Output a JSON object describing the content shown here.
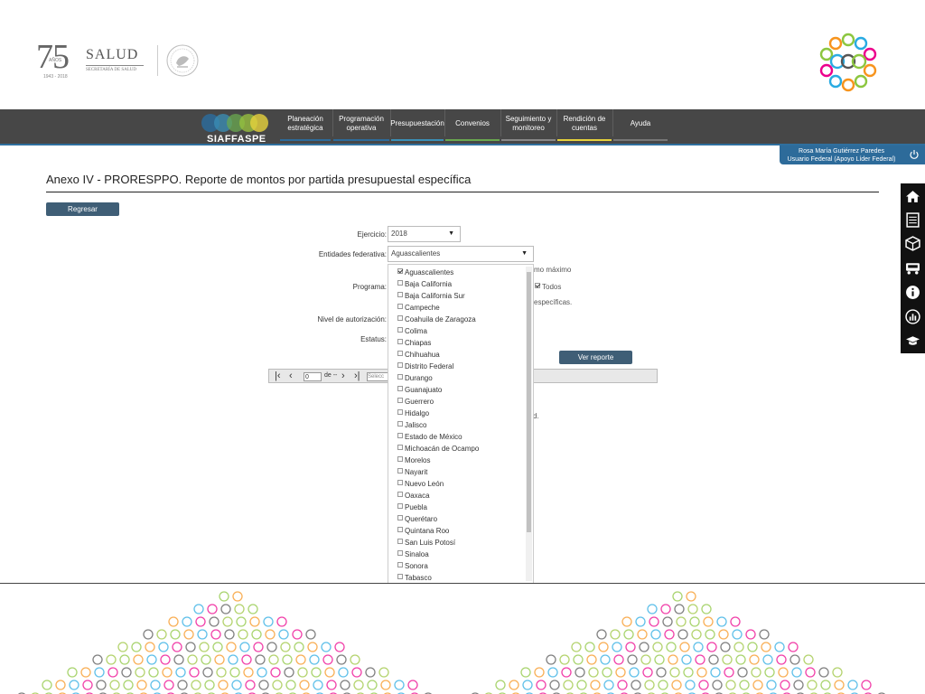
{
  "header": {
    "logo_75_number": "75",
    "logo_75_anos": "AÑOS",
    "logo_75_years": "1943 - 2018",
    "salud_title": "SALUD",
    "salud_subtitle": "SECRETARÍA DE SALUD"
  },
  "nav": {
    "brand": "SIAFFASPE",
    "items": [
      {
        "line1": "Planeación",
        "line2": "estratégica",
        "underline": "#2d6b9a"
      },
      {
        "line1": "Programación",
        "line2": "operativa",
        "underline": "#2d6b9a"
      },
      {
        "line1": "Presupuestación",
        "line2": "",
        "underline": "#3a8fb7"
      },
      {
        "line1": "Convenios",
        "line2": "",
        "underline": "#6aa84f"
      },
      {
        "line1": "Seguimiento y",
        "line2": "monitoreo",
        "underline": "#888888"
      },
      {
        "line1": "Rendición de",
        "line2": "cuentas",
        "underline": "#e6d23c"
      },
      {
        "line1": "Ayuda",
        "line2": "",
        "underline": "#777777"
      }
    ]
  },
  "user": {
    "name": "Rosa María Gutiérrez Paredes",
    "role": "Usuario Federal (Apoyo Líder Federal)"
  },
  "side_toolbar": [
    "home-icon",
    "list-icon",
    "box-icon",
    "truck-icon",
    "info-icon",
    "chart-icon",
    "graduation-cap-icon"
  ],
  "page": {
    "title": "Anexo IV - PRORESPPO. Reporte de montos por partida presupuestal específica",
    "back_button": "Regresar"
  },
  "form": {
    "ejercicio_label": "Ejercicio:",
    "ejercicio_value": "2018",
    "entidades_label": "Entidades federativa:",
    "entidades_value": "Aguascalientes",
    "programa_label": "Programa:",
    "nivel_label": "Nivel de autorización:",
    "estatus_label": "Estatus:",
    "hidden_text_1": "mo máximo",
    "todos_label": "Todos",
    "hidden_text_2": "específicas.",
    "submit": "Ver reporte"
  },
  "entidades_options": [
    {
      "label": "Aguascalientes",
      "checked": true
    },
    {
      "label": "Baja California",
      "checked": false
    },
    {
      "label": "Baja California Sur",
      "checked": false
    },
    {
      "label": "Campeche",
      "checked": false
    },
    {
      "label": "Coahuila de Zaragoza",
      "checked": false
    },
    {
      "label": "Colima",
      "checked": false
    },
    {
      "label": "Chiapas",
      "checked": false
    },
    {
      "label": "Chihuahua",
      "checked": false
    },
    {
      "label": "Distrito Federal",
      "checked": false
    },
    {
      "label": "Durango",
      "checked": false
    },
    {
      "label": "Guanajuato",
      "checked": false
    },
    {
      "label": "Guerrero",
      "checked": false
    },
    {
      "label": "Hidalgo",
      "checked": false
    },
    {
      "label": "Jalisco",
      "checked": false
    },
    {
      "label": "Estado de México",
      "checked": false
    },
    {
      "label": "Michoacán de Ocampo",
      "checked": false
    },
    {
      "label": "Morelos",
      "checked": false
    },
    {
      "label": "Nayarit",
      "checked": false
    },
    {
      "label": "Nuevo León",
      "checked": false
    },
    {
      "label": "Oaxaca",
      "checked": false
    },
    {
      "label": "Puebla",
      "checked": false
    },
    {
      "label": "Querétaro",
      "checked": false
    },
    {
      "label": "Quintana Roo",
      "checked": false
    },
    {
      "label": "San Luis Potosí",
      "checked": false
    },
    {
      "label": "Sinaloa",
      "checked": false
    },
    {
      "label": "Sonora",
      "checked": false
    },
    {
      "label": "Tabasco",
      "checked": false
    }
  ],
  "report_toolbar": {
    "page_value": "0",
    "page_of": "de --",
    "search_placeholder": "Selecc",
    "trailing_text": "d."
  },
  "colors": {
    "nav_bg": "#474747",
    "accent": "#2d6b9a",
    "button": "#3f5e76"
  }
}
